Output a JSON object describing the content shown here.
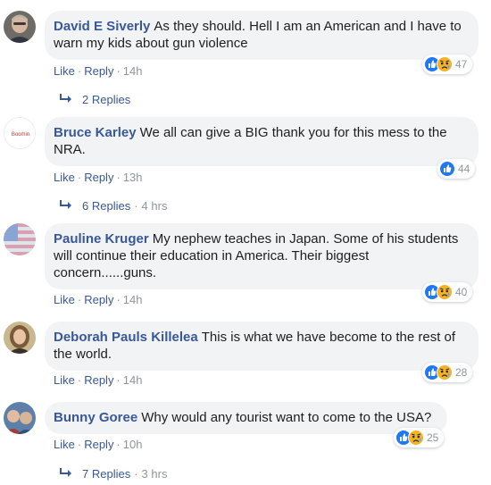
{
  "actions": {
    "like": "Like",
    "reply": "Reply",
    "dot": "·"
  },
  "colors": {
    "link": "#385898",
    "bubble": "#f2f3f5",
    "muted": "#90949c",
    "like_blue": "#2078f4",
    "sad_yellow": "#f7b125"
  },
  "comments": [
    {
      "author": "David E Siverly",
      "text": "As they should. Hell I am an American and I have to warn my kids about gun violence",
      "time": "14h",
      "reactions": [
        "like-icon",
        "sad-icon"
      ],
      "reaction_count": "47",
      "replies": "2 Replies",
      "replies_ago": ""
    },
    {
      "author": "Bruce Karley",
      "avatar_text": "Boomin",
      "text": "We all can give a BIG thank you for this mess to the NRA.",
      "time": "13h",
      "reactions": [
        "like-icon"
      ],
      "reaction_count": "44",
      "replies": "6 Replies",
      "replies_ago": "4 hrs"
    },
    {
      "author": "Pauline Kruger",
      "text": "My nephew teaches in Japan. Some of his students will continue their education in America. Their biggest concern......guns.",
      "time": "14h",
      "reactions": [
        "like-icon",
        "sad-icon"
      ],
      "reaction_count": "40",
      "replies": "",
      "replies_ago": ""
    },
    {
      "author": "Deborah Pauls Killelea",
      "text": "This is what we have become to the rest of the world.",
      "time": "14h",
      "reactions": [
        "like-icon",
        "sad-icon"
      ],
      "reaction_count": "28",
      "replies": "",
      "replies_ago": ""
    },
    {
      "author": "Bunny Goree",
      "text": "Why would any tourist want to come to the USA?",
      "time": "10h",
      "reactions": [
        "like-icon",
        "sad-icon"
      ],
      "reaction_count": "25",
      "replies": "7 Replies",
      "replies_ago": "3 hrs"
    }
  ]
}
